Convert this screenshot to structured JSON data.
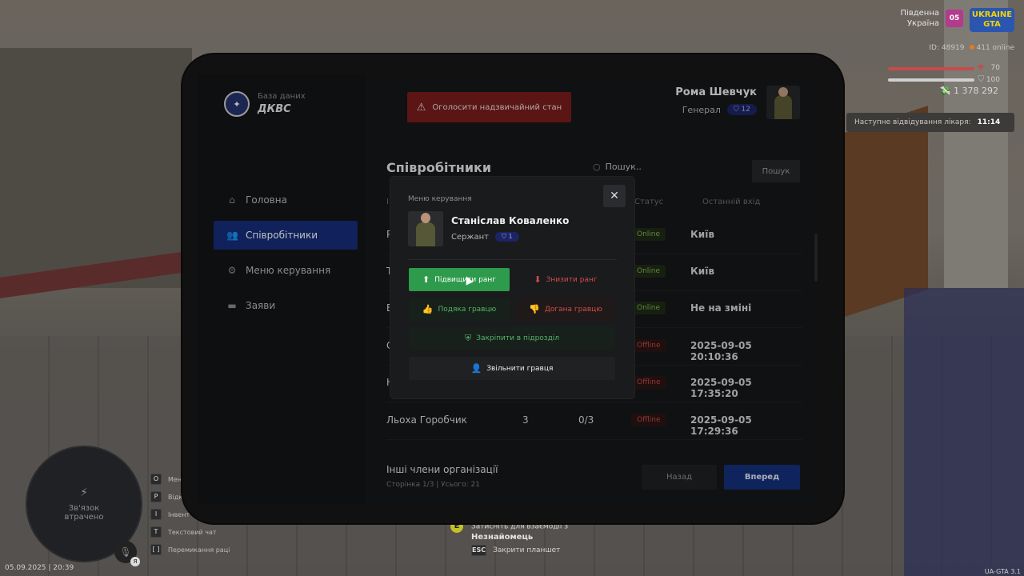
{
  "hud": {
    "server_name_line1": "Південна",
    "server_name_line2": "Україна",
    "server_badge": "05",
    "logo_text_line1": "UKRAINE",
    "logo_text_line2": "GTA",
    "player_id": "ID: 48919",
    "online": "411 online",
    "health": "70",
    "armor": "100",
    "money": "1 378 292",
    "doctor_label": "Наступне відвідування лікаря:",
    "doctor_time": "11:14",
    "minimap_status_line1": "Зв'язок",
    "minimap_status_line2": "втрачено",
    "keys": [
      {
        "key": "O",
        "label": "Мен"
      },
      {
        "key": "P",
        "label": "Відк"
      },
      {
        "key": "I",
        "label": "Інвент"
      },
      {
        "key": "T",
        "label": "Текстовий чат"
      },
      {
        "key": "[ ]",
        "label": "Перемикання раці"
      }
    ],
    "mic_key": "Я",
    "datetime": "05.09.2025 | 20:39",
    "version": "UA-GTA 3.1",
    "interact_key": "E",
    "interact_text": "Затисніть для взаємодії з",
    "interact_target": "Незнайомець",
    "esc_key": "ESC",
    "esc_text": "Закрити планшет"
  },
  "tablet": {
    "org_sub": "База даних",
    "org_name": "ДКВС",
    "emergency_button": "Оголосити надзвичайний стан",
    "user": {
      "name": "Рома Шевчук",
      "rank": "Генерал",
      "rank_level": "12"
    },
    "nav": [
      {
        "label": "Головна",
        "icon": "home-icon"
      },
      {
        "label": "Співробітники",
        "icon": "users-icon",
        "active": true
      },
      {
        "label": "Меню керування",
        "icon": "gear-icon"
      },
      {
        "label": "Заяви",
        "icon": "folder-icon"
      }
    ],
    "section_title": "Співробітники",
    "search_placeholder": "Пошук..",
    "search_button": "Пошук",
    "columns": {
      "id": "І",
      "status": "Статус",
      "last_login": "Останній вхід"
    },
    "rows": [
      {
        "name": "Р",
        "level": "",
        "warns": "",
        "status": "Online",
        "last": "Київ"
      },
      {
        "name": "Т",
        "level": "",
        "warns": "",
        "status": "Online",
        "last": "Київ"
      },
      {
        "name": "В",
        "level": "",
        "warns": "",
        "status": "Online",
        "last": "Не на зміні"
      },
      {
        "name": "С",
        "level": "",
        "warns": "",
        "status": "Offline",
        "last": "2025-09-05 20:10:36"
      },
      {
        "name": "Н",
        "level": "",
        "warns": "",
        "status": "Offline",
        "last": "2025-09-05 17:35:20"
      },
      {
        "name": "Льоха Горобчик",
        "level": "3",
        "warns": "0/3",
        "status": "Offline",
        "last": "2025-09-05 17:29:36"
      }
    ],
    "other_title": "Інші члени організації",
    "pagination": "Сторінка 1/3 | Усього: 21",
    "back_button": "Назад",
    "next_button": "Вперед"
  },
  "modal": {
    "title": "Меню керування",
    "name": "Станіслав Коваленко",
    "rank": "Сержант",
    "rank_level": "1",
    "promote": "Підвищити ранг",
    "demote": "Знизити ранг",
    "thank": "Подяка гравцю",
    "reprimand": "Догана гравцю",
    "assign": "Закріпити в підрозділ",
    "fire": "Звільнити гравця"
  }
}
